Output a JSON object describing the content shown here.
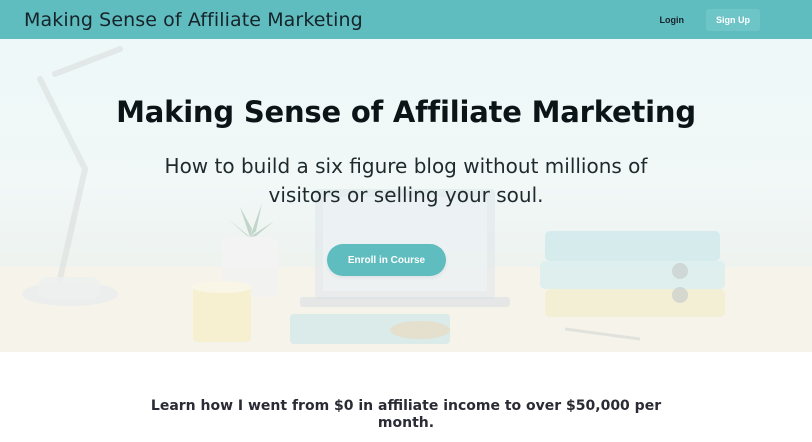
{
  "header": {
    "brand": "Making Sense of Affiliate Marketing",
    "login": "Login",
    "signup": "Sign Up"
  },
  "hero": {
    "title": "Making Sense of Affiliate Marketing",
    "subtitle": "How to build a six figure blog without millions of visitors or selling your soul.",
    "cta": "Enroll in Course"
  },
  "intro": {
    "text": "Learn how I went from $0 in affiliate income to over $50,000 per month."
  },
  "colors": {
    "accent": "#5fbcbf",
    "hero_bg": "#eef8f8"
  }
}
